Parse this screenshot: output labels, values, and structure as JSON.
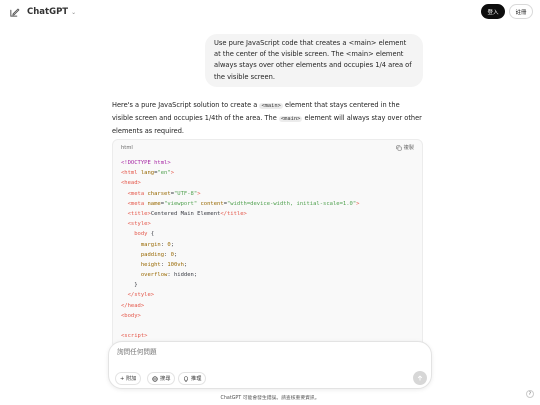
{
  "header": {
    "brand": "ChatGPT",
    "login_label": "登入",
    "signup_label": "註冊"
  },
  "user_message": "Use pure JavaScript code that creates a <main> element at the center of the visible screen. The <main> element always stays over other elements and occupies 1/4 area of the visible screen.",
  "assistant": {
    "intro_1": "Here's a pure JavaScript solution to create a ",
    "intro_code_1": "<main>",
    "intro_2": " element that stays centered in the visible screen and occupies 1/4th of the area. The ",
    "intro_code_2": "<main>",
    "intro_3": " element will always stay over other elements as required."
  },
  "codeblock": {
    "language": "html",
    "copy_label": "複製",
    "lines": [
      [
        {
          "t": "<!DOCTYPE html>",
          "c": "kw"
        }
      ],
      [
        {
          "t": "<html ",
          "c": "tag"
        },
        {
          "t": "lang",
          "c": "attr"
        },
        {
          "t": "=",
          "c": "plain"
        },
        {
          "t": "\"en\"",
          "c": "str"
        },
        {
          "t": ">",
          "c": "tag"
        }
      ],
      [
        {
          "t": "<head>",
          "c": "tag"
        }
      ],
      [
        {
          "t": "  <meta ",
          "c": "tag"
        },
        {
          "t": "charset",
          "c": "attr"
        },
        {
          "t": "=",
          "c": "plain"
        },
        {
          "t": "\"UTF-8\"",
          "c": "str"
        },
        {
          "t": ">",
          "c": "tag"
        }
      ],
      [
        {
          "t": "  <meta ",
          "c": "tag"
        },
        {
          "t": "name",
          "c": "attr"
        },
        {
          "t": "=",
          "c": "plain"
        },
        {
          "t": "\"viewport\"",
          "c": "str"
        },
        {
          "t": " content",
          "c": "attr"
        },
        {
          "t": "=",
          "c": "plain"
        },
        {
          "t": "\"width=device-width, initial-scale=1.0\"",
          "c": "str"
        },
        {
          "t": ">",
          "c": "tag"
        }
      ],
      [
        {
          "t": "  <title>",
          "c": "tag"
        },
        {
          "t": "Centered Main Element",
          "c": "text"
        },
        {
          "t": "</title>",
          "c": "tag"
        }
      ],
      [
        {
          "t": "  <style>",
          "c": "tag"
        }
      ],
      [
        {
          "t": "    body ",
          "c": "prop"
        },
        {
          "t": "{",
          "c": "plain"
        }
      ],
      [
        {
          "t": "      margin",
          "c": "attr"
        },
        {
          "t": ": ",
          "c": "plain"
        },
        {
          "t": "0",
          "c": "num"
        },
        {
          "t": ";",
          "c": "plain"
        }
      ],
      [
        {
          "t": "      padding",
          "c": "attr"
        },
        {
          "t": ": ",
          "c": "plain"
        },
        {
          "t": "0",
          "c": "num"
        },
        {
          "t": ";",
          "c": "plain"
        }
      ],
      [
        {
          "t": "      height",
          "c": "attr"
        },
        {
          "t": ": ",
          "c": "plain"
        },
        {
          "t": "100vh",
          "c": "num"
        },
        {
          "t": ";",
          "c": "plain"
        }
      ],
      [
        {
          "t": "      overflow",
          "c": "attr"
        },
        {
          "t": ": ",
          "c": "plain"
        },
        {
          "t": "hidden",
          "c": "text"
        },
        {
          "t": ";",
          "c": "plain"
        }
      ],
      [
        {
          "t": "    }",
          "c": "plain"
        }
      ],
      [
        {
          "t": "  </style>",
          "c": "tag"
        }
      ],
      [
        {
          "t": "</head>",
          "c": "tag"
        }
      ],
      [
        {
          "t": "<body>",
          "c": "tag"
        }
      ],
      [
        {
          "t": "",
          "c": "plain"
        }
      ],
      [
        {
          "t": "<script>",
          "c": "tag"
        }
      ]
    ]
  },
  "composer": {
    "placeholder": "詢問任何問題",
    "attach_label": "+ 附加",
    "search_label": "搜尋",
    "reason_label": "推理"
  },
  "footer": {
    "disclaimer": "ChatGPT 可能會發生錯誤。請查核重要資訊。"
  },
  "help_label": "?",
  "colors": {
    "accent": "#0d0d0d",
    "bubble": "#f4f4f4",
    "code_bg": "#f9f9f9"
  }
}
